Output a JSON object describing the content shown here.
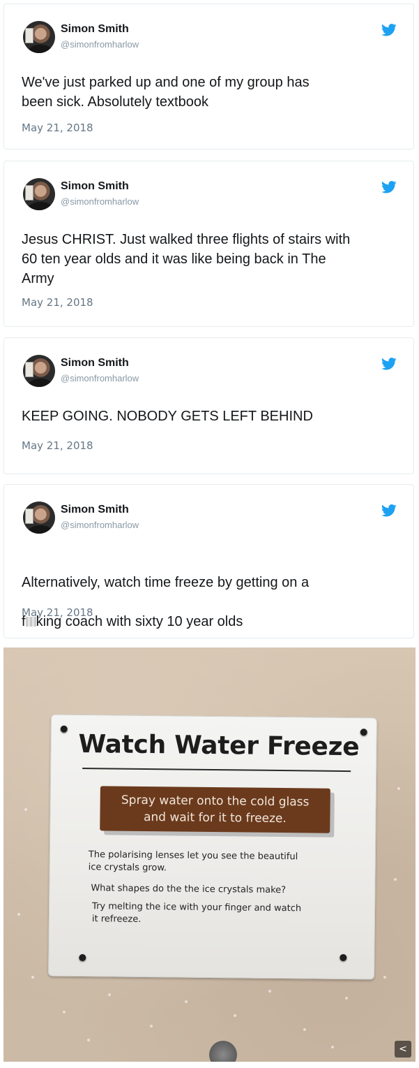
{
  "tweets": [
    {
      "name": "Simon Smith",
      "handle": "@simonfromharlow",
      "text": "We've just parked up and one of my group has\nbeen sick. Absolutely textbook",
      "date": "May 21, 2018"
    },
    {
      "name": "Simon Smith",
      "handle": "@simonfromharlow",
      "text": "Jesus CHRIST. Just walked three flights of stairs with\n60 ten year olds and it was like being back in The\nArmy",
      "date": "May 21, 2018"
    },
    {
      "name": "Simon Smith",
      "handle": "@simonfromharlow",
      "text": "KEEP GOING. NOBODY GETS LEFT BEHIND",
      "date": "May 21, 2018"
    },
    {
      "name": "Simon Smith",
      "handle": "@simonfromharlow",
      "text_line1": "Alternatively, watch time freeze by getting on a",
      "text_line2_pre": "f",
      "text_line2_post": "king coach with sixty 10 year olds",
      "date": "May 21, 2018"
    }
  ],
  "photo": {
    "sign_title": "Watch Water Freeze",
    "instruction": "Spray water onto the cold glass\nand wait for it to freeze.",
    "para1": "The polarising lenses let you see the beautiful\nice crystals grow.",
    "para2": "What shapes do the the ice crystals make?",
    "para3": "Try melting the ice with your finger and watch\nit refreeze."
  },
  "icons": {
    "twitter": "twitter-bird-icon",
    "share": "share-icon"
  },
  "colors": {
    "twitter_blue": "#1da1f2",
    "name": "#14171a",
    "meta": "#657786",
    "sign_box": "#6b3a1c"
  }
}
